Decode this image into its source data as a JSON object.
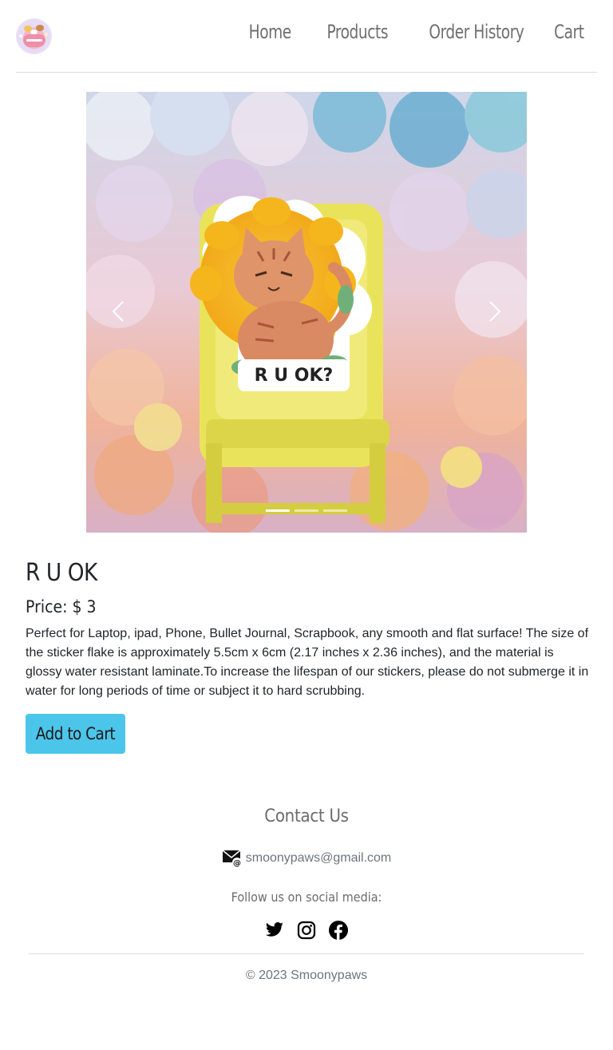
{
  "nav": {
    "links": [
      "Home",
      "Products",
      "Order History",
      "Cart"
    ]
  },
  "carousel": {
    "prev_label": "Previous",
    "next_label": "Next",
    "sticker_text": "R U OK?",
    "slide_count": 3,
    "active_slide": 1
  },
  "product": {
    "title": "R U OK",
    "price_label": "Price: $ 3",
    "description": "Perfect for Laptop, ipad, Phone, Bullet Journal, Scrapbook, any smooth and flat surface! The size of the sticker flake is approximately 5.5cm x 6cm (2.17 inches x 2.36 inches), and the material is glossy water resistant laminate.To increase the lifespan of our stickers, please do not submerge it in water for long periods of time or subject it to hard scrubbing.",
    "add_to_cart_label": "Add to Cart"
  },
  "footer": {
    "contact_title": "Contact Us",
    "email": "smoonypaws@gmail.com",
    "follow_text": "Follow us on social media:",
    "social": [
      "twitter-icon",
      "instagram-icon",
      "facebook-icon"
    ],
    "copyright": "© 2023 Smoonypaws"
  },
  "colors": {
    "button_bg": "#4cc5ea",
    "nav_text": "#6f6f6f"
  }
}
